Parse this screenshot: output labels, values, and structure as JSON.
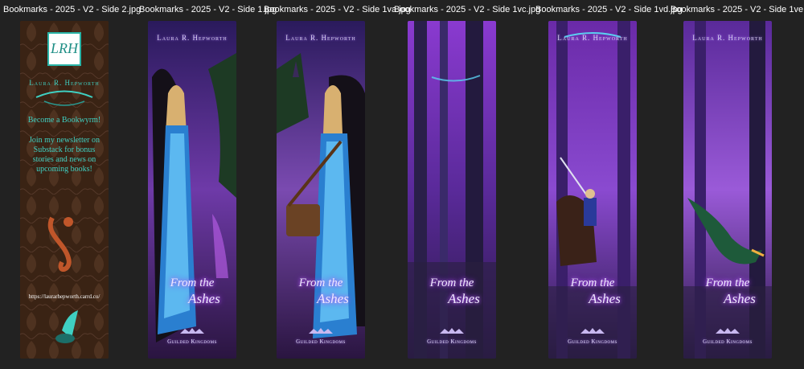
{
  "files": [
    {
      "filename": "Bookmarks - 2025 - V2 - Side 2.jpg"
    },
    {
      "filename": "Bookmarks - 2025 - V2 - Side 1.jpg"
    },
    {
      "filename": "Bookmarks - 2025 - V2 - Side 1va.jpg"
    },
    {
      "filename": "Bookmarks - 2025 - V2 - Side 1vc.jpg"
    },
    {
      "filename": "Bookmarks - 2025 - V2 - Side 1vd.jpg"
    },
    {
      "filename": "Bookmarks - 2025 - V2 - Side 1ve.jpg"
    }
  ],
  "back_side": {
    "logo_text": "LRH",
    "author": "Laura R. Hepworth",
    "headline": "Become a Bookwyrm!",
    "body": "Join my newsletter on Substack for bonus stories and news on upcoming books!",
    "url": "https://laurarhepworth.carrd.co/"
  },
  "front_side": {
    "author": "Laura R. Hepworth",
    "title_line1": "From the",
    "title_line2": "Ashes",
    "series": "Guilded Kingdoms"
  },
  "colors": {
    "background": "#222222",
    "caption_text": "#ffffff",
    "back_brown": "#3a2314",
    "back_teal": "#3fd0c2",
    "front_purple": "#6a2aa8",
    "glow_violet": "#c070ff"
  }
}
